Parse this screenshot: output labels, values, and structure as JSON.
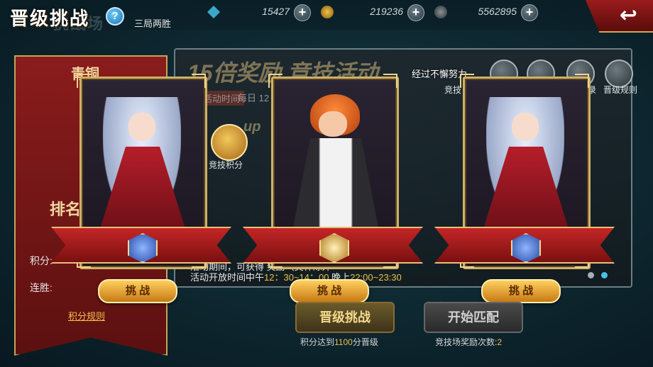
{
  "header": {
    "title": "晋级挑战",
    "title_ghost": "挑战场",
    "help": "?",
    "subtitle": "三局两胜",
    "resources": [
      {
        "icon": "gem-icon",
        "value": "15427",
        "color": "#3aa7c9"
      },
      {
        "icon": "gold-coin-icon",
        "value": "219236",
        "color": "#c98d2a"
      },
      {
        "icon": "silver-coin-icon",
        "value": "5562895",
        "color": "#6a7278"
      }
    ],
    "plus": "+",
    "back": "↩"
  },
  "banner": {
    "tier": "青铜",
    "rank_label": "排名",
    "score_label": "积分:",
    "streak_label": "连胜:",
    "rule_link": "积分规则"
  },
  "event": {
    "title": "15倍奖励 竞技活动",
    "time_label": "活动时间",
    "time_value": "每日 12",
    "up_text": "up",
    "arena_points_label": "竞技积分",
    "desc_line1": "活动期间，可获得 奖励（奖杯除外",
    "desc_line2_prefix": "活动开放时间中午",
    "desc_line2_highlight": "12：30~14：00",
    "desc_line2_mid": "晚上",
    "desc_line2_highlight2": "22:00~23:30",
    "right_icon_labels": [
      "竞技",
      "录",
      "晋级规则"
    ]
  },
  "cards": [
    {
      "character": "silver-haired-girl",
      "emblem": "blue",
      "button": "挑 战"
    },
    {
      "character": "orange-haired-boy",
      "emblem": "gold",
      "button": "挑 战"
    },
    {
      "character": "silver-haired-girl",
      "emblem": "blue",
      "button": "挑 战"
    }
  ],
  "card_caption": "经过不懈努力",
  "bottom": {
    "promo_button": "晋级挑战",
    "match_button": "开始匹配",
    "promo_note_prefix": "积分达到",
    "promo_note_value": "1100",
    "promo_note_suffix": "分晋级",
    "match_note_prefix": "竞技场奖励次数:",
    "match_note_value": "2"
  }
}
